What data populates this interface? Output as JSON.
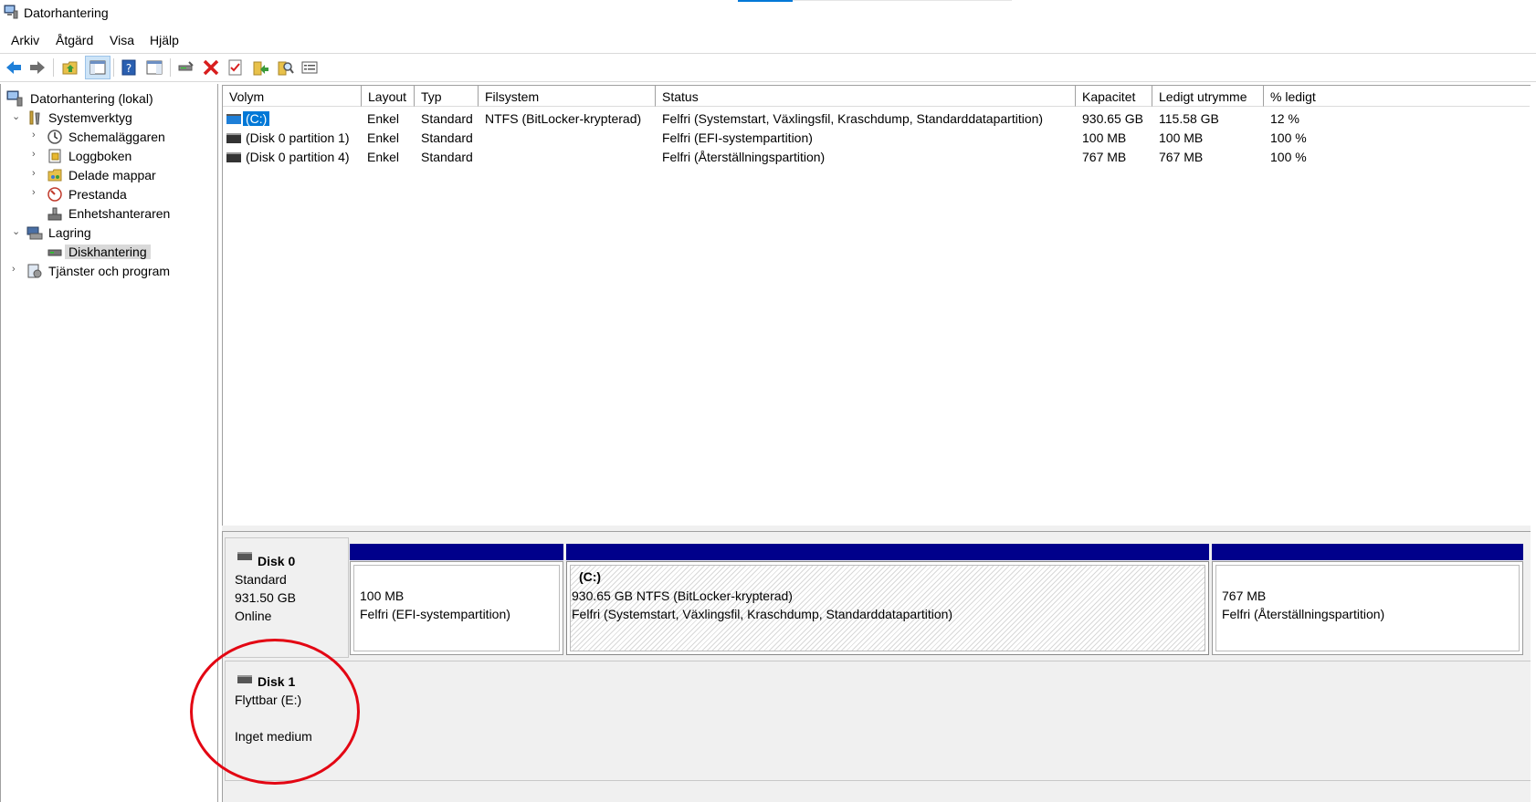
{
  "window": {
    "title": "Datorhantering"
  },
  "menu": {
    "items": [
      "Arkiv",
      "Åtgärd",
      "Visa",
      "Hjälp"
    ]
  },
  "toolbar": {
    "icons": [
      "back-arrow-icon",
      "forward-arrow-icon",
      "up-folder-icon",
      "show-hide-tree-icon",
      "help-icon",
      "console-tree-icon",
      "connect-icon",
      "delete-icon",
      "properties-icon",
      "export-icon",
      "search-icon",
      "details-icon"
    ],
    "colors": {
      "back": "#1e7fd8",
      "forward": "#6e6e6e",
      "delete": "#d81e1e"
    }
  },
  "tree": {
    "root": "Datorhantering (lokal)",
    "system_tools": "Systemverktyg",
    "task_scheduler": "Schemaläggaren",
    "event_viewer": "Loggboken",
    "shared_folders": "Delade mappar",
    "performance": "Prestanda",
    "device_manager": "Enhetshanteraren",
    "storage": "Lagring",
    "disk_management": "Diskhantering",
    "services": "Tjänster och program"
  },
  "volume_table": {
    "columns": [
      "Volym",
      "Layout",
      "Typ",
      "Filsystem",
      "Status",
      "Kapacitet",
      "Ledigt utrymme",
      "% ledigt"
    ],
    "rows": [
      {
        "volym": "(C:)",
        "layout": "Enkel",
        "typ": "Standard",
        "filsystem": "NTFS (BitLocker-krypterad)",
        "status": "Felfri (Systemstart, Växlingsfil, Kraschdump, Standarddatapartition)",
        "kapacitet": "930.65 GB",
        "ledigt": "115.58 GB",
        "procent": "12 %"
      },
      {
        "volym": "(Disk 0 partition 1)",
        "layout": "Enkel",
        "typ": "Standard",
        "filsystem": "",
        "status": "Felfri (EFI-systempartition)",
        "kapacitet": "100 MB",
        "ledigt": "100 MB",
        "procent": "100 %"
      },
      {
        "volym": "(Disk 0 partition 4)",
        "layout": "Enkel",
        "typ": "Standard",
        "filsystem": "",
        "status": "Felfri (Återställningspartition)",
        "kapacitet": "767 MB",
        "ledigt": "767 MB",
        "procent": "100 %"
      }
    ]
  },
  "disks": {
    "disk0": {
      "name": "Disk 0",
      "type": "Standard",
      "size": "931.50 GB",
      "state": "Online",
      "partitions": [
        {
          "size": "100 MB",
          "status": "Felfri (EFI-systempartition)"
        },
        {
          "label": "(C:)",
          "size": "930.65 GB NTFS (BitLocker-krypterad)",
          "status": "Felfri (Systemstart, Växlingsfil, Kraschdump, Standarddatapartition)"
        },
        {
          "size": "767 MB",
          "status": "Felfri (Återställningspartition)"
        }
      ]
    },
    "disk1": {
      "name": "Disk 1",
      "type": "Flyttbar (E:)",
      "state": "Inget medium"
    }
  },
  "colors": {
    "partition_bar": "#00008b",
    "selection": "#0078d7",
    "annotation_circle": "#e30613"
  }
}
